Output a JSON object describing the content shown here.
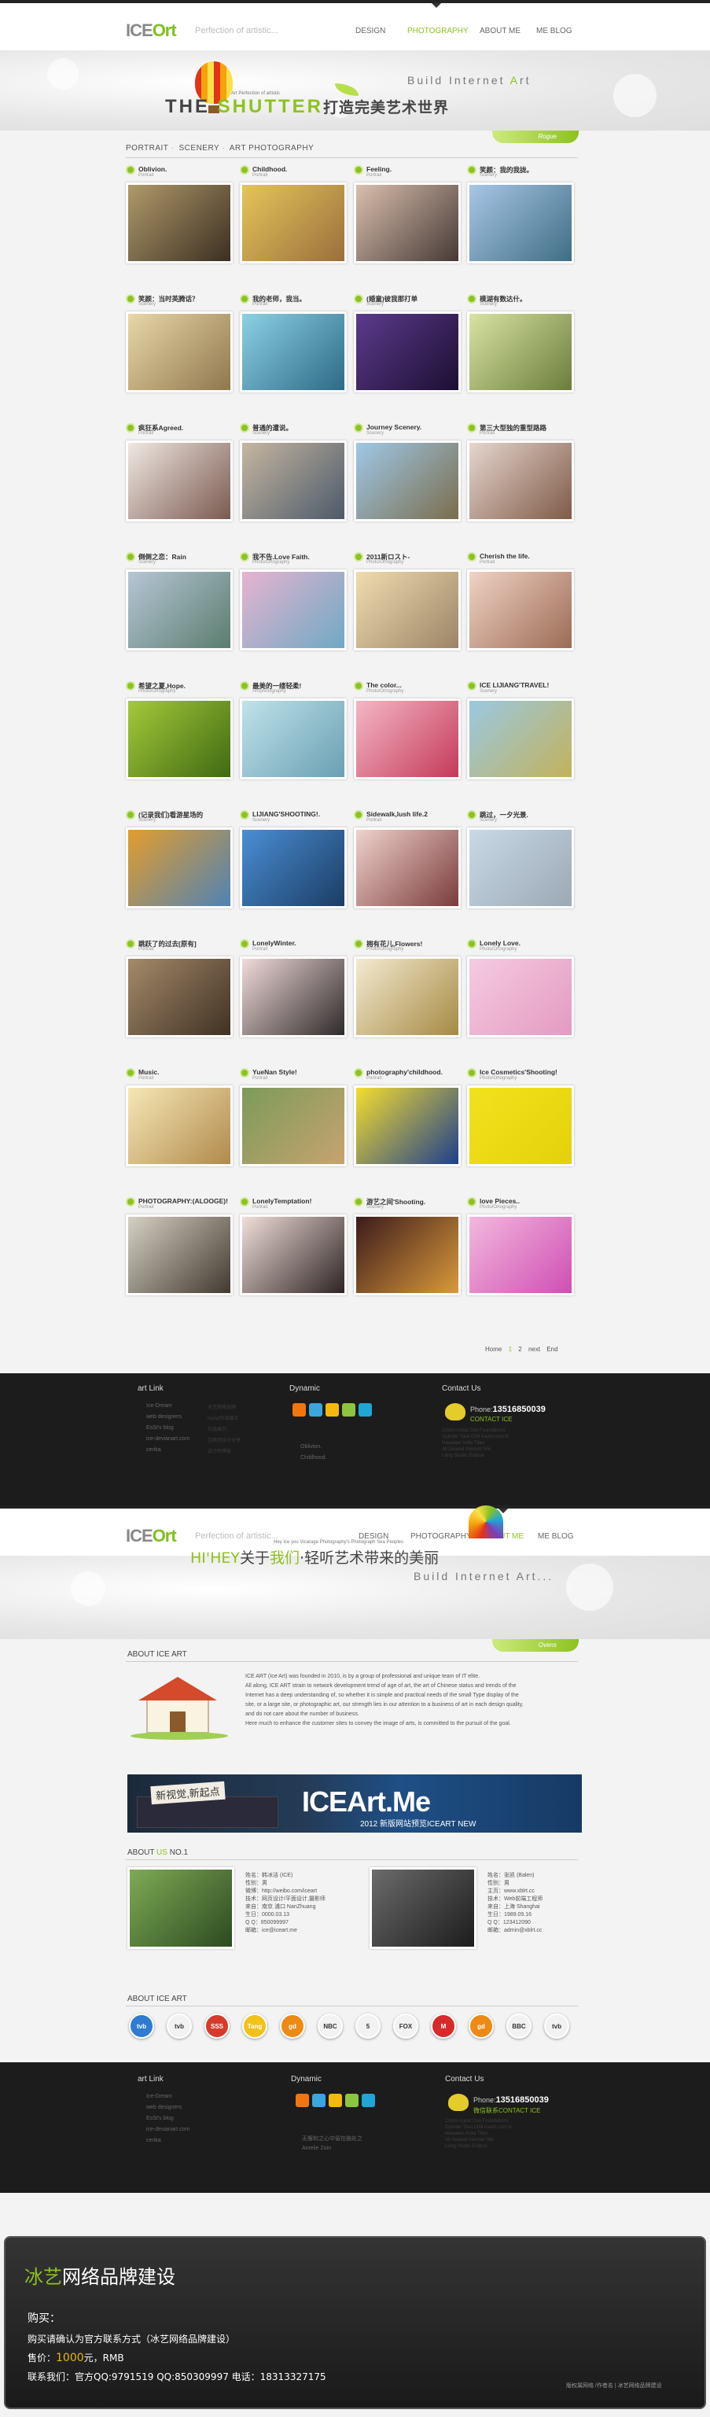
{
  "page1": {
    "logo": "ICE",
    "logo_o": "Ort",
    "tagline": "Perfection of artistic...",
    "menu": [
      "DESIGN",
      "PHOTOGRAPHY",
      "ABOUT ME",
      "ME BLOG"
    ],
    "active": 1,
    "banner_small": "Art Perfection of artistic",
    "banner_title_a": "THE ",
    "banner_title_b": "SHUTTER",
    "banner_title_cn": "打造完美艺术世界",
    "build_a": "Build Internet ",
    "build_b": "A",
    "build_c": "rt",
    "greenbar_text": "Rogue",
    "breadcrumb": [
      "PORTRAIT",
      "SCENERY",
      "ART PHOTOGRAPHY"
    ]
  },
  "photos": [
    {
      "t": "Oblivion.",
      "s": "Portrait",
      "c1": "#b09a6a",
      "c2": "#3c2f22"
    },
    {
      "t": "Childhood.",
      "s": "Portrait",
      "c1": "#e5c55a",
      "c2": "#9b6f3d"
    },
    {
      "t": "Feeling.",
      "s": "Portrait",
      "c1": "#d9bfae",
      "c2": "#463935"
    },
    {
      "t": "笑颜：我的我拢。",
      "s": "Scenery",
      "c1": "#a8c6e6",
      "c2": "#3f6e84"
    },
    {
      "t": "笑颜：当时英腾话？",
      "s": "Scenery",
      "c1": "#e9d7a8",
      "c2": "#8f774d"
    },
    {
      "t": "我的老师，我当。",
      "s": "Portrait",
      "c1": "#8cd1e4",
      "c2": "#2d6a86"
    },
    {
      "t": "(婚童)彼我那打单",
      "s": "Scenery",
      "c1": "#5c3a8c",
      "c2": "#1c0f32"
    },
    {
      "t": "模湖有数达什。",
      "s": "Scenery",
      "c1": "#d8e3a2",
      "c2": "#6c7d3b"
    },
    {
      "t": "疯狂系Agreed.",
      "s": "Portrait",
      "c1": "#f0e8e2",
      "c2": "#7a5a50"
    },
    {
      "t": "普通的遭说。",
      "s": "Scenery",
      "c1": "#c6b6a0",
      "c2": "#4c5a6a"
    },
    {
      "t": "Journey Scenery.",
      "s": "Scenery",
      "c1": "#9fc8e8",
      "c2": "#7a6d4c"
    },
    {
      "t": "第三大型独的重型路路",
      "s": "Portrait",
      "c1": "#e6d6ce",
      "c2": "#7f5a48"
    },
    {
      "t": "倒倒之恋：Rain",
      "s": "Scenery",
      "c1": "#b7c6d6",
      "c2": "#5a7d6e"
    },
    {
      "t": "我不告.Love Faith.",
      "s": "Photo/Ortography",
      "c1": "#e6b4d0",
      "c2": "#6fa9c4"
    },
    {
      "t": "2011新ロスト-",
      "s": "Photo/Ortography",
      "c1": "#f1dcb0",
      "c2": "#9c8466"
    },
    {
      "t": "Cherish the life.",
      "s": "Portrait",
      "c1": "#f0d2c4",
      "c2": "#9c6c55"
    },
    {
      "t": "希望之夏,Hope.",
      "s": "Photo/Ortography",
      "c1": "#a5c93a",
      "c2": "#3f6a12"
    },
    {
      "t": "最美的一缕轻柔!",
      "s": "Art/photography",
      "c1": "#bfe2ea",
      "c2": "#6aa0b3"
    },
    {
      "t": "The color...",
      "s": "Photo/Ortography",
      "c1": "#f4b7c4",
      "c2": "#c43a5a"
    },
    {
      "t": "ICE LIJIANG'TRAVEL!",
      "s": "Scenery",
      "c1": "#9ac9e2",
      "c2": "#c2b25a"
    },
    {
      "t": "(记录我们)看游星场的",
      "s": "Scenery",
      "c1": "#e39d2c",
      "c2": "#4f82b4"
    },
    {
      "t": "LIJIANG'SHOOTING!.",
      "s": "Scenery",
      "c1": "#4a8ed4",
      "c2": "#1b3d64"
    },
    {
      "t": "Sidewalk,lush life.2",
      "s": "Portrait",
      "c1": "#f0d2cc",
      "c2": "#7a3c3c"
    },
    {
      "t": "跳过，一夕光景.",
      "s": "Scenery",
      "c1": "#c9d9e6",
      "c2": "#9ba9b5"
    },
    {
      "t": "跳跃了的过去[原有]",
      "s": "Portrait",
      "c1": "#a58a6a",
      "c2": "#3f3123"
    },
    {
      "t": "LonelyWinter.",
      "s": "Portrait",
      "c1": "#f1dada",
      "c2": "#2f2a2a"
    },
    {
      "t": "拥有花儿,Flowers!",
      "s": "Photo/Ortography",
      "c1": "#f3ead0",
      "c2": "#a68a44"
    },
    {
      "t": "Lonely Love.",
      "s": "Photo/Ortography",
      "c1": "#f5cbe0",
      "c2": "#e49ac1"
    },
    {
      "t": "Music.",
      "s": "Portrait",
      "c1": "#f7e7b6",
      "c2": "#b08a4c"
    },
    {
      "t": "YueNan Style!",
      "s": "Portrait",
      "c1": "#7c9b5a",
      "c2": "#c7a36f"
    },
    {
      "t": "photography'childhood.",
      "s": "Portrait",
      "c1": "#f4dd2f",
      "c2": "#1d3f8c"
    },
    {
      "t": "Ice Cosmetics'Shooting!",
      "s": "Photo/Ortography",
      "c1": "#f2e21d",
      "c2": "#e4d10b"
    },
    {
      "t": "PHOTOGRAPHY:(ALOOGE)!",
      "s": "Portrait",
      "c1": "#d7d1c4",
      "c2": "#413a30"
    },
    {
      "t": "LonelyTemptation!",
      "s": "Portrait",
      "c1": "#f0ded8",
      "c2": "#2e2425"
    },
    {
      "t": "游艺之间'Shooting.",
      "s": "Scenery",
      "c1": "#3c1b1b",
      "c2": "#d99a3b"
    },
    {
      "t": "love Pieces..",
      "s": "Photo/Ortography",
      "c1": "#f3b8dd",
      "c2": "#cf4fb4"
    }
  ],
  "pager": [
    "Home",
    "1",
    "2",
    "next",
    "End"
  ],
  "footer": {
    "c1": "art Link",
    "c2": "Dynamic",
    "c3": "Contact Us",
    "links": [
      "Ice-Dream",
      "web designers",
      "EsSt's blog",
      "ice-devianart.com",
      "cerika"
    ],
    "links_r": [
      "冰艺网络品牌",
      "IceArt作品展示",
      "作品展示:",
      "互联网设计分享",
      "设计师博客"
    ],
    "dyn": [
      "Oblivion.",
      "Childhood."
    ],
    "phone_label": "Phone:",
    "phone": "13516850039",
    "contact": "CONTACT ICE",
    "ct": [
      "Cindin Icetat Ceo Foundations",
      "Gyinder Tikei     Chill IceArt.com.fx",
      "Hawaiian India Tibet",
      "All Geared Internet Site",
      "Liiing Studio Eclipse"
    ]
  },
  "page2": {
    "logo": "ICE",
    "logo_o": "Ort",
    "tagline": "Perfection of artistic...",
    "menu": [
      "DESIGN",
      "PHOTOGRAPHY",
      "ABOUT ME",
      "ME BLOG"
    ],
    "active": 2,
    "banner_small": "Hey Ice you Vicarage Photography's Photograph Sea Peoples",
    "hi_a": "HI'HEY",
    "hi_b": "关于",
    "hi_c": "我们",
    "hi_d": "·轻听艺术带来的美丽",
    "build": "Build Internet Art...",
    "greenbar_text": "Ovens",
    "about_title": "ABOUT ICE ART",
    "about": [
      "ICE ART (Ice Art) was founded in 2010, is by a group of professional and unique team of IT elite.",
      "All along, ICE ART strain to network development trend of age of art, the art of Chinese status and trends of the",
      "Internet has a deep understanding of, so whether it is simple and practical needs of the small Type display of the",
      "site, or a large site, or photographic art, our strength lies in our attention to a business of art in each design quality,",
      "and do not care about the number of business.",
      "Here much to enhance the customer sites to convey the image of arts, is committed to the pursuit of the goal."
    ],
    "promo_hand": "新视觉,新起点",
    "promo_big": "ICEArt.Me",
    "promo_sub": "2012 新版网站预览ICEART NEW",
    "us_a": "ABOUT ",
    "us_b": "US",
    "us_c": " NO.1",
    "m1": [
      "姓名：韩冰洁 (ICE)",
      "性别：男",
      "微博：http://weibo.com/iceart",
      "技术：网页设计/平面设计,摄影师",
      "来自：南京 浦口 NanZhuang",
      "生日：0000.03.13",
      "Q Q：850099997",
      "邮箱：ice@iceart.me"
    ],
    "m2": [
      "姓名：张凯 (Balen)",
      "性别：男",
      "主页：www.xblrt.cc",
      "技术：Web前端工程师",
      "来自：上海 Shanghai",
      "生日：1989.09.16",
      "Q Q：123412090",
      "邮箱：admin@xblrt.cc"
    ],
    "clients_title": "ABOUT ICE ART",
    "clients": [
      "tvb",
      "tvb",
      "SSS",
      "Tang",
      "gd",
      "NBC",
      "5",
      "FOX",
      "M",
      "gd",
      "BBC",
      "tvb"
    ],
    "client_colors": [
      "#2e7bd1",
      "#f2f2f2",
      "#d73a2a",
      "#f2c219",
      "#ee8a14",
      "#f2f2f2",
      "#f2f2f2",
      "#f2f2f2",
      "#d72a2a",
      "#ee8a14",
      "#f2f2f2",
      "#f2f2f2"
    ]
  },
  "footer2": {
    "c1": "art Link",
    "c2": "Dynamic",
    "c3": "Contact Us",
    "links": [
      "Ice-Dream",
      "web designers",
      "EsSt's blog",
      "ice-devianart.com",
      "cerika"
    ],
    "dyn": [
      "无懈和之心中留在脑处之",
      "Amelie Zoin"
    ],
    "phone_label": "Phone:",
    "phone": "13516850039",
    "contact": "微信联系CONTACT ICE",
    "ct": [
      "Cindin Icetat Ceo Foundations",
      "Gyinder Tikei     Chill IceArt.com.fx",
      "Hawaiian India Tibet",
      "All Geared Internet Site",
      "Liiing Studio Eclipse"
    ]
  },
  "ad": {
    "title_g": "冰艺",
    "title_w": "网络品牌建设",
    "buy": "购买：",
    "line1": "购买请确认为官方联系方式（冰艺网络品牌建设）",
    "price_a": "售价：",
    "price": "1000",
    "price_b": "元，RMB",
    "contact": "联系我们：官方QQ:9791519  QQ:850309997    电话：18313327175",
    "credit": "版权属网络 /作者名 | 冰艺网络品牌建设"
  },
  "colors": {
    "accent": "#8dc21f",
    "footer": "#1c1c1c"
  }
}
